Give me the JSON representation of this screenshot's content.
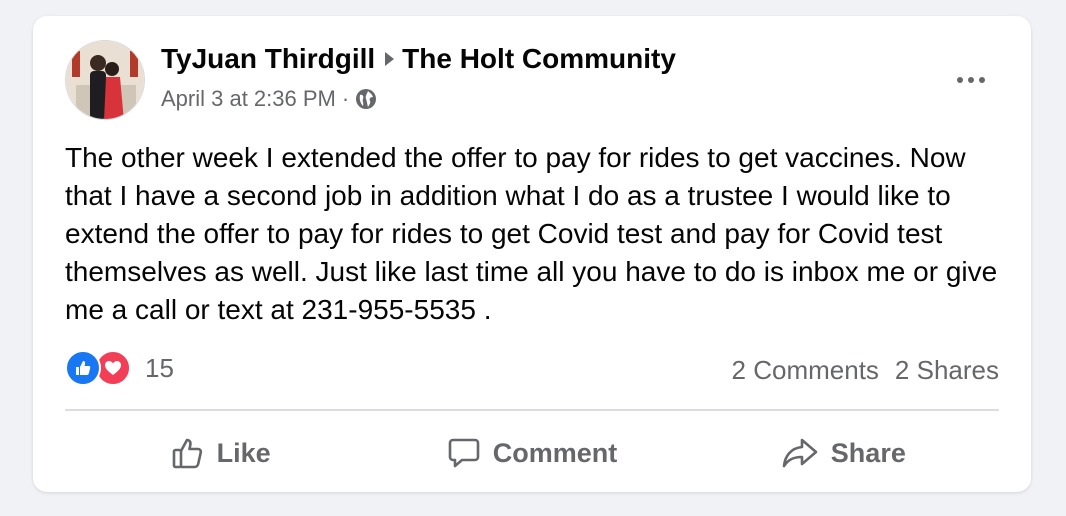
{
  "post": {
    "author": "TyJuan Thirdgill",
    "group": "The Holt Community",
    "timestamp": "April 3 at 2:36 PM",
    "separator": "·",
    "privacy_icon": "globe-icon",
    "body": "The other week I extended the offer to pay for rides to get vaccines. Now that I have a second job in addition what I do as a trustee I would like to extend the offer to pay for rides to get Covid test and pay for Covid test themselves as well. Just like last time all you have to do is inbox me or give me a call or text at 231-955-5535  ."
  },
  "reactions": {
    "icons": [
      "like-icon",
      "love-icon"
    ],
    "count": "15"
  },
  "stats": {
    "comments": "2 Comments",
    "shares": "2 Shares"
  },
  "actions": {
    "like": "Like",
    "comment": "Comment",
    "share": "Share"
  },
  "colors": {
    "like_blue": "#1877f2",
    "love_red": "#f33e58",
    "secondary_text": "#65676b",
    "primary_text": "#050505"
  }
}
